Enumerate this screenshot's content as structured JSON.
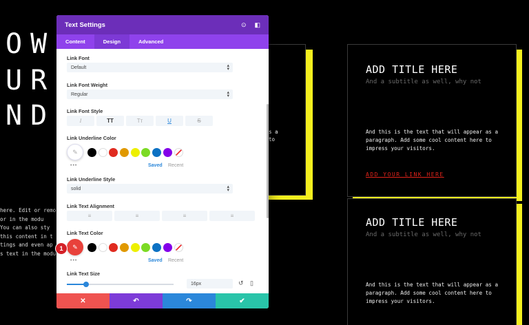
{
  "background": {
    "big_lines": [
      "OW",
      "UR",
      "ND"
    ],
    "para_lines": [
      "here. Edit or remo",
      "  or  in  the  modu",
      " You  can  also  sty",
      "this  content  in  t",
      "tings  and  even  ap",
      "s  text  in  the  modu"
    ],
    "left_card_lines": [
      "s a",
      "to"
    ],
    "cards": [
      {
        "title": "ADD TITLE HERE",
        "subtitle": "And a subtitle as well, why not",
        "paragraph": "And this is the text that will appear as a paragraph. Add some cool content here to impress your visitors.",
        "link": "ADD YOUR LINK HERE"
      },
      {
        "title": "ADD TITLE HERE",
        "subtitle": "And a subtitle as well, why not",
        "paragraph": "And this is the text that will appear as a paragraph. Add some cool content here to impress your visitors."
      }
    ]
  },
  "modal": {
    "title": "Text Settings",
    "header_icons": [
      "target-icon",
      "expand-icon"
    ],
    "tabs": [
      {
        "label": "Content",
        "active": false
      },
      {
        "label": "Design",
        "active": true
      },
      {
        "label": "Advanced",
        "active": false
      }
    ],
    "link_font": {
      "label": "Link Font",
      "value": "Default"
    },
    "link_font_weight": {
      "label": "Link Font Weight",
      "value": "Regular"
    },
    "link_font_style": {
      "label": "Link Font Style",
      "buttons": [
        "I",
        "TT",
        "Tт",
        "U",
        "S"
      ]
    },
    "link_underline_color": {
      "label": "Link Underline Color",
      "swatches": [
        "#000000",
        "#ffffff",
        "#e02b20",
        "#e09900",
        "#edf000",
        "#7cda24",
        "#0c71c3",
        "#8300e9"
      ],
      "saved": "Saved",
      "recent": "Recent",
      "more": "•••"
    },
    "link_underline_style": {
      "label": "Link Underline Style",
      "value": "solid"
    },
    "link_text_alignment": {
      "label": "Link Text Alignment"
    },
    "link_text_color": {
      "label": "Link Text Color",
      "swatches": [
        "#000000",
        "#ffffff",
        "#e02b20",
        "#e09900",
        "#edf000",
        "#7cda24",
        "#0c71c3",
        "#8300e9"
      ],
      "saved": "Saved",
      "recent": "Recent",
      "more": "•••",
      "badge": "1"
    },
    "link_text_size": {
      "label": "Link Text Size",
      "value": "16px",
      "slider_fraction": 0.18
    },
    "footer": [
      {
        "name": "cancel",
        "icon": "✕",
        "color": "#ef5350"
      },
      {
        "name": "undo",
        "icon": "↶",
        "color": "#7d3bd8"
      },
      {
        "name": "redo",
        "icon": "↷",
        "color": "#2b87da"
      },
      {
        "name": "save",
        "icon": "✔",
        "color": "#29c4a9"
      }
    ]
  }
}
